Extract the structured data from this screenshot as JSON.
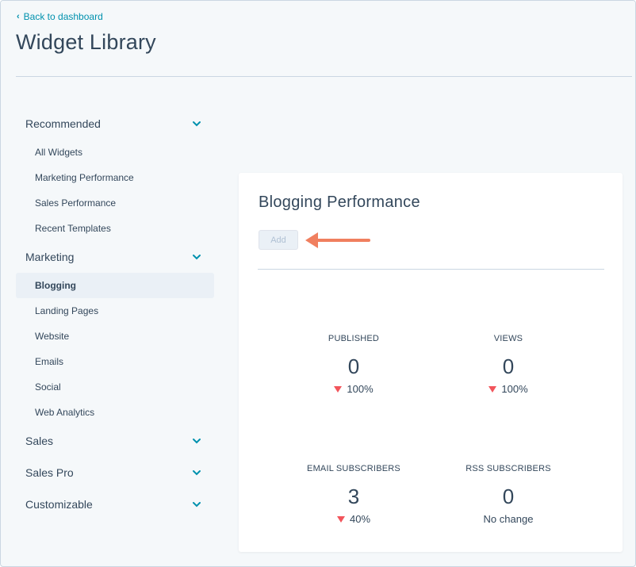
{
  "header": {
    "back_link": "Back to dashboard",
    "title": "Widget Library"
  },
  "sidebar": {
    "groups": [
      {
        "label": "Recommended",
        "items": [
          "All Widgets",
          "Marketing Performance",
          "Sales Performance",
          "Recent Templates"
        ]
      },
      {
        "label": "Marketing",
        "items": [
          "Blogging",
          "Landing Pages",
          "Website",
          "Emails",
          "Social",
          "Web Analytics"
        ],
        "active_item": "Blogging"
      },
      {
        "label": "Sales",
        "items": []
      },
      {
        "label": "Sales Pro",
        "items": []
      },
      {
        "label": "Customizable",
        "items": []
      }
    ]
  },
  "card": {
    "title": "Blogging Performance",
    "add_label": "Add",
    "stats": [
      {
        "label": "PUBLISHED",
        "value": "0",
        "change": "100%",
        "direction": "down"
      },
      {
        "label": "VIEWS",
        "value": "0",
        "change": "100%",
        "direction": "down"
      },
      {
        "label": "EMAIL SUBSCRIBERS",
        "value": "3",
        "change": "40%",
        "direction": "down"
      },
      {
        "label": "RSS SUBSCRIBERS",
        "value": "0",
        "change": "No change",
        "direction": "none"
      }
    ]
  },
  "colors": {
    "accent": "#0091ae",
    "text": "#33475b",
    "negative": "#f2545b",
    "arrow": "#f07f5f",
    "background": "#f5f8fa"
  },
  "icons": {
    "back": "chevron-left-icon",
    "expand": "chevron-down-icon",
    "trend_down": "triangle-down-icon",
    "annotation": "arrow-left-icon"
  }
}
